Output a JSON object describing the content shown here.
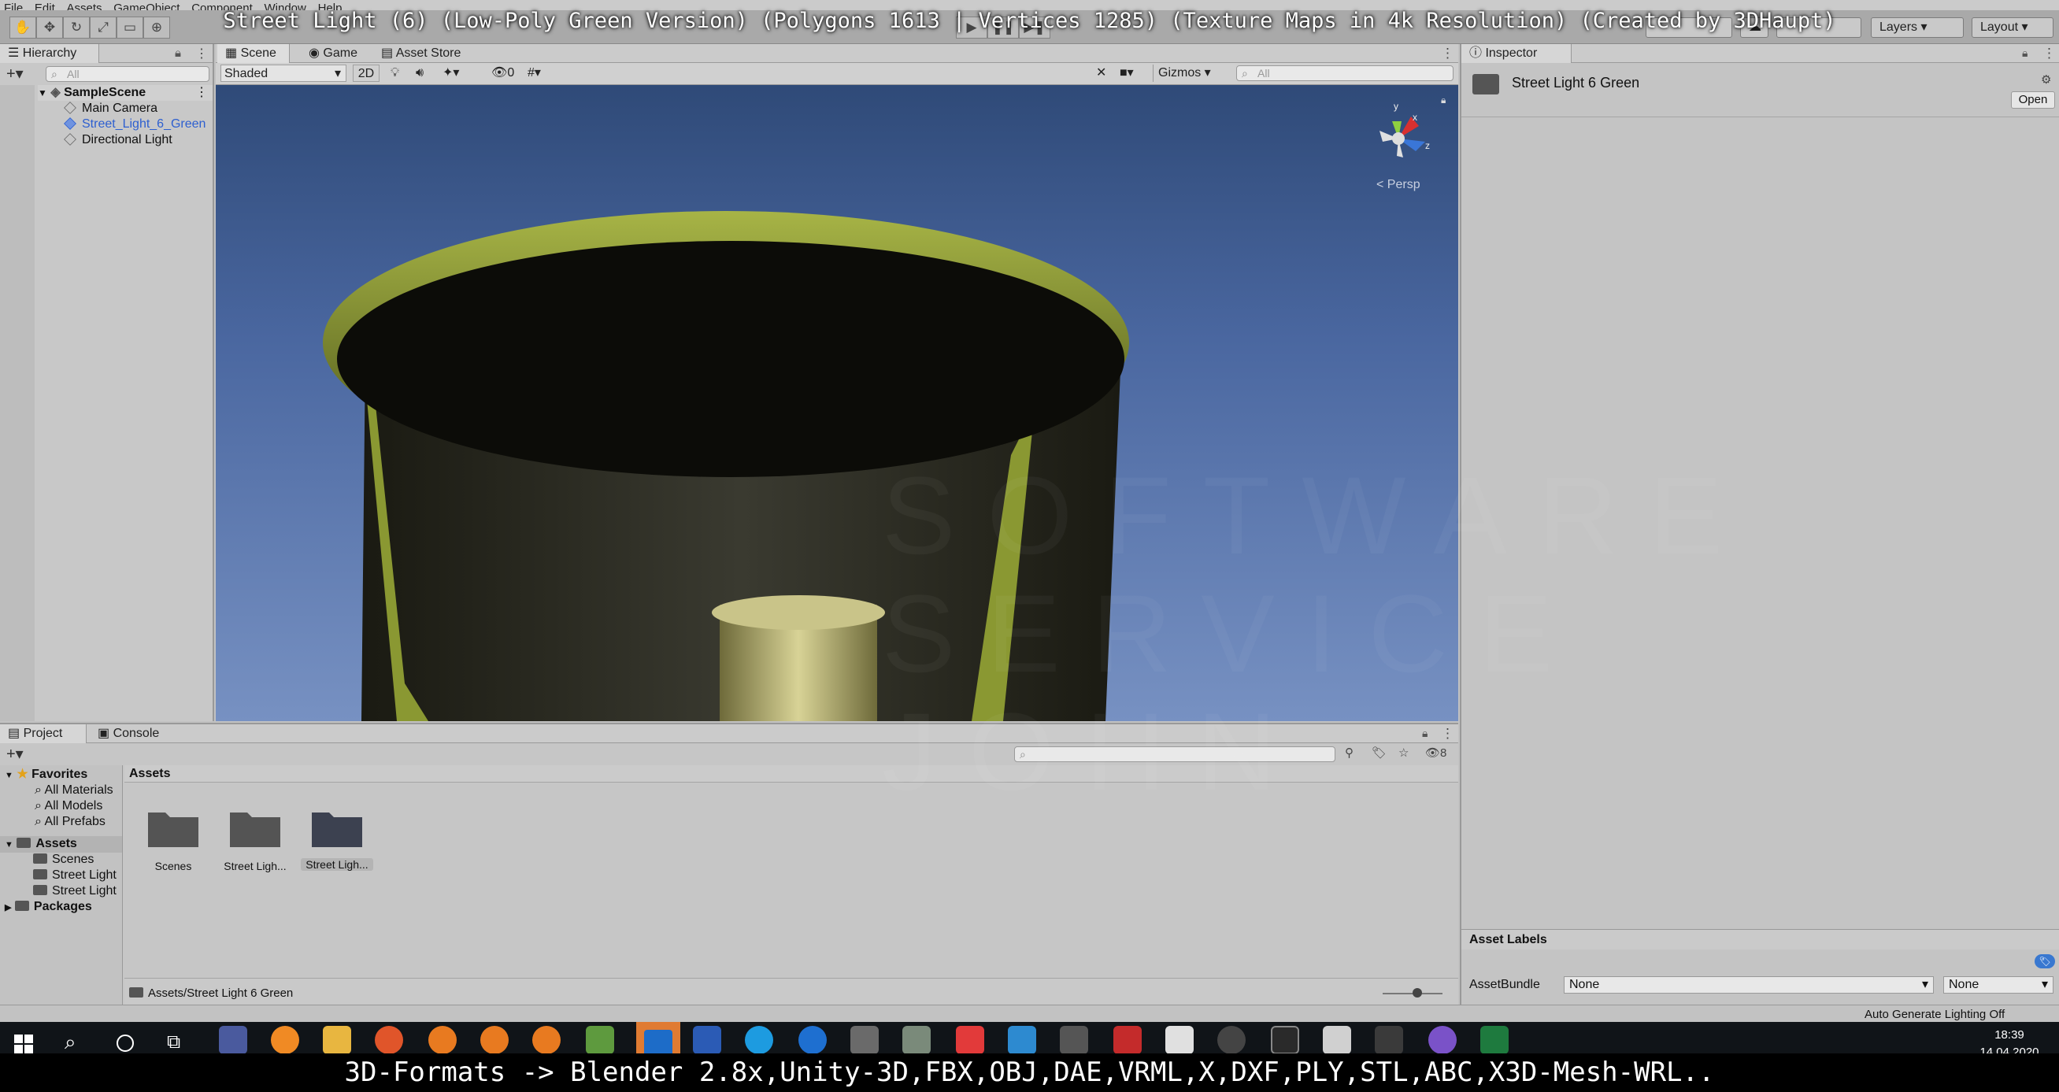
{
  "video_title": "Street Light (6) (Low-Poly Green Version) (Polygons 1613 | Vertices 1285) (Texture Maps in 4k Resolution) (Created by 3DHaupt)",
  "bottom_caption": "3D-Formats -> Blender 2.8x,Unity-3D,FBX,OBJ,DAE,VRML,X,DXF,PLY,STL,ABC,X3D-Mesh-WRL..",
  "menu": [
    "File",
    "Edit",
    "Assets",
    "GameObject",
    "Component",
    "Window",
    "Help"
  ],
  "toolbar": {
    "layers": "Layers",
    "layout": "Layout"
  },
  "hierarchy": {
    "tab": "Hierarchy",
    "search_placeholder": "All",
    "scene": "SampleScene",
    "items": [
      "Main Camera",
      "Street_Light_6_Green",
      "Directional Light"
    ]
  },
  "scene_view": {
    "tabs": [
      "Scene",
      "Game",
      "Asset Store"
    ],
    "shading": "Shaded",
    "mode_2d": "2D",
    "hidden_count": "0",
    "gizmos": "Gizmos",
    "search_placeholder": "All",
    "projection": "< Persp",
    "axis_labels": {
      "y": "y",
      "x": "x",
      "z": "z"
    }
  },
  "inspector": {
    "tab": "Inspector",
    "asset_name": "Street Light 6 Green",
    "open_button": "Open",
    "asset_labels": "Asset Labels",
    "assetbundle_label": "AssetBundle",
    "assetbundle_value": "None",
    "variant_value": "None"
  },
  "project": {
    "tabs": [
      "Project",
      "Console"
    ],
    "favorites_label": "Favorites",
    "favorites": [
      "All Materials",
      "All Models",
      "All Prefabs"
    ],
    "assets_label": "Assets",
    "asset_folders": [
      "Scenes",
      "Street Light",
      "Street Light"
    ],
    "packages_label": "Packages",
    "breadcrumb": "Assets",
    "grid_items": [
      "Scenes",
      "Street Ligh...",
      "Street Ligh..."
    ],
    "path": "Assets/Street Light 6 Green",
    "hidden_count": "8"
  },
  "status": {
    "lighting": "Auto Generate Lighting Off"
  },
  "taskbar": {
    "time": "18:39",
    "date": "14.04.2020"
  },
  "watermark": [
    "SOFTWARE",
    "SERVICE",
    "JOHN"
  ],
  "colors": {
    "sky_top": "#2f4a78",
    "sky_bottom": "#7791c2",
    "lamp_green": "#8fa03a",
    "selection_blue": "#2d5fd0",
    "taskbar": "#101418"
  }
}
